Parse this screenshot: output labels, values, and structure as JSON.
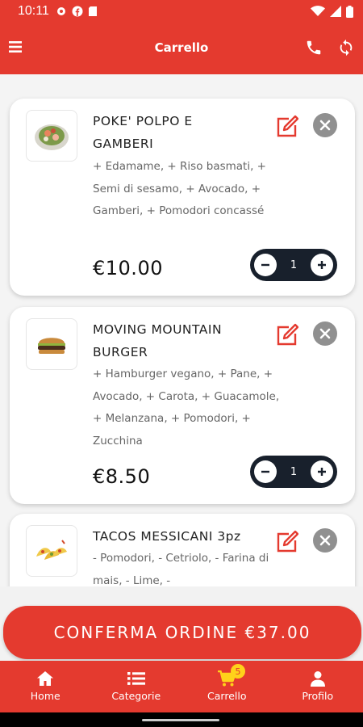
{
  "status_bar": {
    "time": "10:11"
  },
  "app_bar": {
    "title": "Carrello"
  },
  "cart_items": [
    {
      "name": "POKE' POLPO E GAMBERI",
      "options": "+ Edamame, + Riso basmati, + Semi di sesamo, + Avocado, + Gamberi, + Pomodori concassé",
      "price": "€10.00",
      "quantity": "1"
    },
    {
      "name": "MOVING MOUNTAIN BURGER",
      "options": "+ Hamburger vegano, + Pane, + Avocado, + Carota, + Guacamole, + Melanzana, + Pomodori, + Zucchina",
      "price": "€8.50",
      "quantity": "1"
    },
    {
      "name": "TACOS MESSICANI 3pz",
      "options": "- Pomodori, - Cetriolo, - Farina di mais, - Lime, -"
    }
  ],
  "confirm_button": {
    "label": "CONFERMA ORDINE €37.00"
  },
  "bottom_nav": {
    "items": [
      {
        "label": "Home"
      },
      {
        "label": "Categorie"
      },
      {
        "label": "Carrello",
        "badge": "5"
      },
      {
        "label": "Profilo"
      }
    ]
  },
  "colors": {
    "primary": "#e43a2f",
    "active_tab": "#ffd21a",
    "stepper": "#18202c"
  }
}
